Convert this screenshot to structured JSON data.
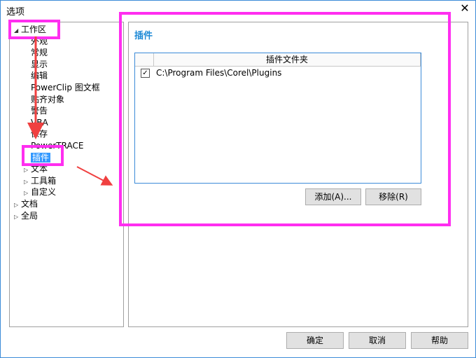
{
  "window": {
    "title": "选项",
    "close_glyph": "✕"
  },
  "tree": {
    "items": [
      {
        "label": "工作区",
        "arrow": "◢",
        "indent": 0
      },
      {
        "label": "外观",
        "arrow": "",
        "indent": 1
      },
      {
        "label": "常规",
        "arrow": "",
        "indent": 1
      },
      {
        "label": "显示",
        "arrow": "",
        "indent": 1
      },
      {
        "label": "编辑",
        "arrow": "",
        "indent": 1
      },
      {
        "label": "PowerClip 图文框",
        "arrow": "",
        "indent": 1
      },
      {
        "label": "贴齐对象",
        "arrow": "",
        "indent": 1
      },
      {
        "label": "警告",
        "arrow": "",
        "indent": 1
      },
      {
        "label": "VBA",
        "arrow": "",
        "indent": 1
      },
      {
        "label": "保存",
        "arrow": "",
        "indent": 1
      },
      {
        "label": "PowerTRACE",
        "arrow": "",
        "indent": 1
      },
      {
        "label": "插件",
        "arrow": "",
        "indent": 1,
        "selected": true
      },
      {
        "label": "文本",
        "arrow": "▷",
        "indent": 1
      },
      {
        "label": "工具箱",
        "arrow": "▷",
        "indent": 1
      },
      {
        "label": "自定义",
        "arrow": "▷",
        "indent": 1
      },
      {
        "label": "文档",
        "arrow": "▷",
        "indent": 0
      },
      {
        "label": "全局",
        "arrow": "▷",
        "indent": 0
      }
    ]
  },
  "content": {
    "section_title": "插件",
    "list": {
      "column_header": "插件文件夹",
      "rows": [
        {
          "checked": true,
          "path": "C:\\Program Files\\Corel\\Plugins"
        }
      ],
      "check_glyph": "✓"
    },
    "add_button": "添加(A)...",
    "remove_button": "移除(R)"
  },
  "footer": {
    "ok_button": "确定",
    "cancel_button": "取消",
    "help_button": "帮助"
  },
  "colors": {
    "highlight": "#ff2ef0",
    "arrow": "#f04040",
    "selection": "#3399ff",
    "section_title": "#1e8ad6"
  }
}
